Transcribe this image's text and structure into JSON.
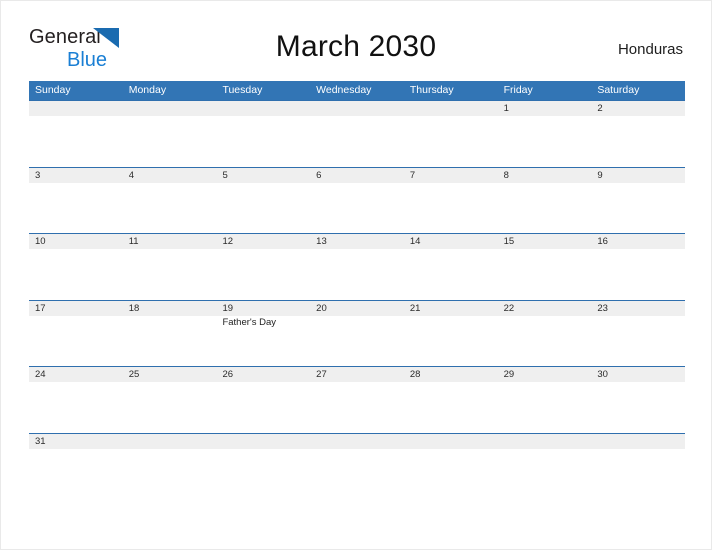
{
  "brand": {
    "line1": "General",
    "line2": "Blue",
    "triangle_color": "#1a6bb0",
    "line2_color": "#1a7fd4"
  },
  "header": {
    "title": "March 2030",
    "country": "Honduras"
  },
  "colors": {
    "header_blue": "#3275b5",
    "row_rule_blue": "#2f6fae",
    "daynum_band": "#efefef",
    "page_background": "#ffffff"
  },
  "calendar": {
    "month": "March",
    "year": "2030",
    "weekdays": [
      "Sunday",
      "Monday",
      "Tuesday",
      "Wednesday",
      "Thursday",
      "Friday",
      "Saturday"
    ],
    "weeks": [
      [
        {
          "day": "",
          "event": ""
        },
        {
          "day": "",
          "event": ""
        },
        {
          "day": "",
          "event": ""
        },
        {
          "day": "",
          "event": ""
        },
        {
          "day": "",
          "event": ""
        },
        {
          "day": "1",
          "event": ""
        },
        {
          "day": "2",
          "event": ""
        }
      ],
      [
        {
          "day": "3",
          "event": ""
        },
        {
          "day": "4",
          "event": ""
        },
        {
          "day": "5",
          "event": ""
        },
        {
          "day": "6",
          "event": ""
        },
        {
          "day": "7",
          "event": ""
        },
        {
          "day": "8",
          "event": ""
        },
        {
          "day": "9",
          "event": ""
        }
      ],
      [
        {
          "day": "10",
          "event": ""
        },
        {
          "day": "11",
          "event": ""
        },
        {
          "day": "12",
          "event": ""
        },
        {
          "day": "13",
          "event": ""
        },
        {
          "day": "14",
          "event": ""
        },
        {
          "day": "15",
          "event": ""
        },
        {
          "day": "16",
          "event": ""
        }
      ],
      [
        {
          "day": "17",
          "event": ""
        },
        {
          "day": "18",
          "event": ""
        },
        {
          "day": "19",
          "event": "Father's Day"
        },
        {
          "day": "20",
          "event": ""
        },
        {
          "day": "21",
          "event": ""
        },
        {
          "day": "22",
          "event": ""
        },
        {
          "day": "23",
          "event": ""
        }
      ],
      [
        {
          "day": "24",
          "event": ""
        },
        {
          "day": "25",
          "event": ""
        },
        {
          "day": "26",
          "event": ""
        },
        {
          "day": "27",
          "event": ""
        },
        {
          "day": "28",
          "event": ""
        },
        {
          "day": "29",
          "event": ""
        },
        {
          "day": "30",
          "event": ""
        }
      ],
      [
        {
          "day": "31",
          "event": ""
        },
        {
          "day": "",
          "event": ""
        },
        {
          "day": "",
          "event": ""
        },
        {
          "day": "",
          "event": ""
        },
        {
          "day": "",
          "event": ""
        },
        {
          "day": "",
          "event": ""
        },
        {
          "day": "",
          "event": ""
        }
      ]
    ]
  }
}
